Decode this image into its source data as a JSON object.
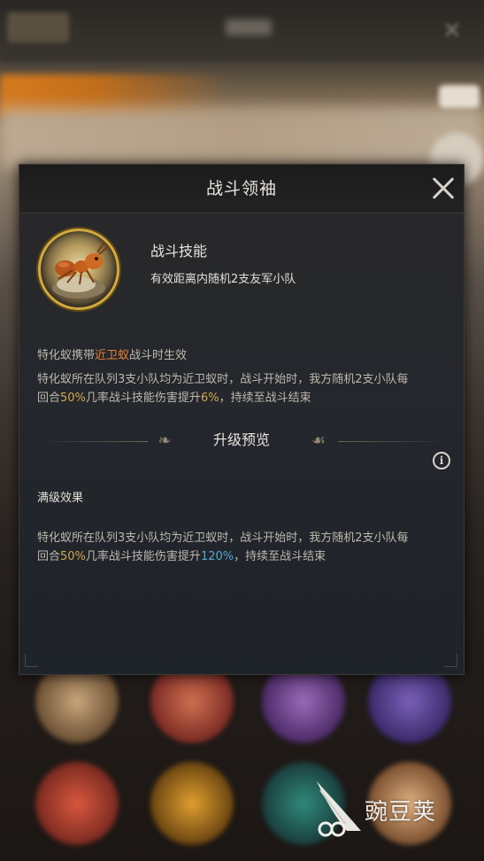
{
  "dialog": {
    "title": "战斗领袖",
    "close_icon": "close-icon"
  },
  "skill": {
    "icon": "fire-ant-portrait",
    "name": "战斗技能",
    "description": "有效距离内随机2支友军小队"
  },
  "condition": {
    "prefix": "特化蚁携带",
    "highlight": "近卫蚁",
    "suffix": "战斗时生效",
    "highlight_color": "#e5803a"
  },
  "effect": {
    "line1": "特化蚁所在队列3支小队均为近卫蚁时，战斗开始时，我方随机2支小队每",
    "line2_a": "回合",
    "chance": "50%",
    "line2_b": "几率战斗技能伤害提升",
    "bonus": "6%",
    "line2_c": "，持续至战斗结束"
  },
  "upgrade": {
    "section_title": "升级预览",
    "info_icon": "info-icon",
    "info_glyph": "i",
    "max_label": "满级效果",
    "line1": "特化蚁所在队列3支小队均为近卫蚁时，战斗开始时，我方随机2支小队每",
    "line2_a": "回合",
    "chance": "50%",
    "line2_b": "几率战斗技能伤害提升",
    "bonus": "120%",
    "line2_c": "，持续至战斗结束",
    "bonus_color": "#56a8d0"
  },
  "watermark": {
    "text": "豌豆荚"
  }
}
